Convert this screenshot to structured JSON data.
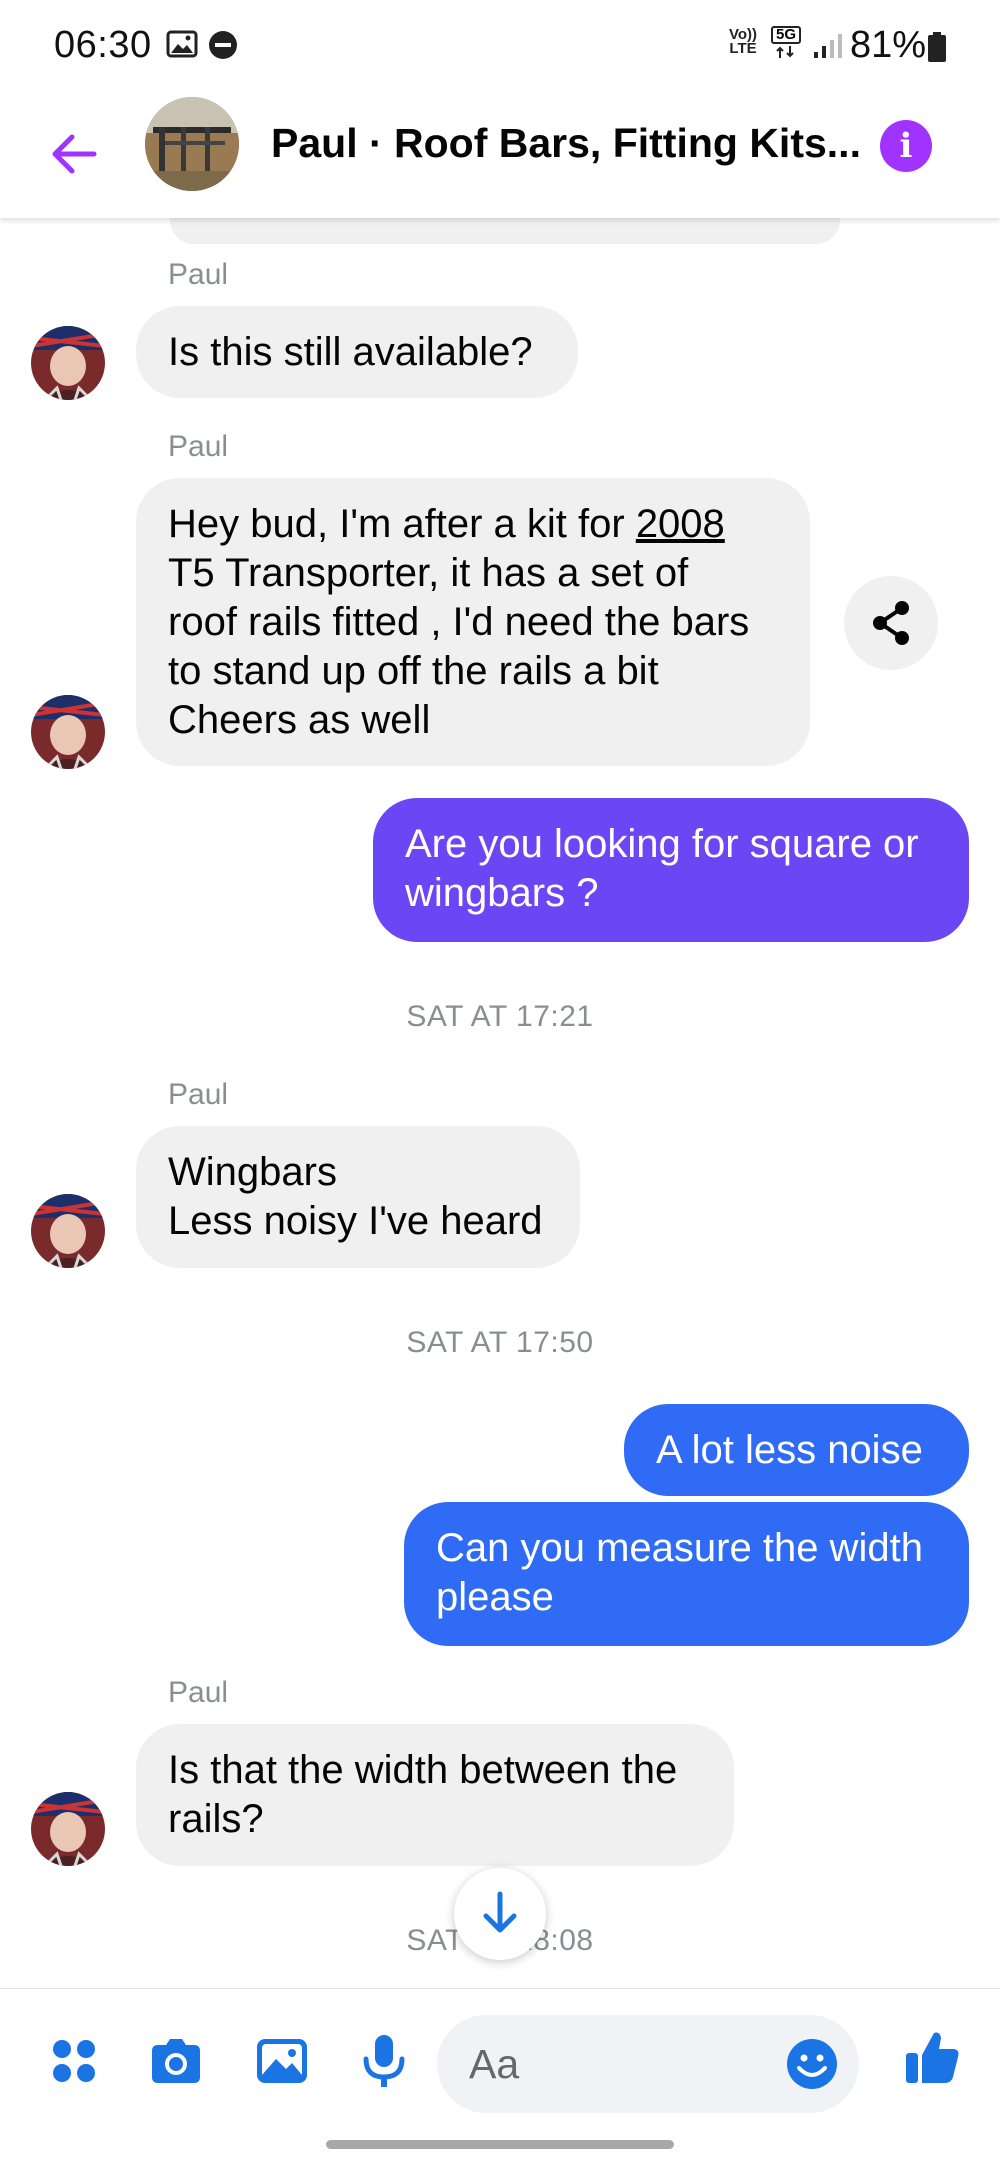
{
  "status_bar": {
    "time": "06:30",
    "network_volte": "Vo)) LTE",
    "network_5g": "5G",
    "battery": "81%",
    "icons": [
      "gallery-icon",
      "do-not-disturb-icon",
      "signal-icon",
      "battery-icon"
    ]
  },
  "header": {
    "title": "Paul · Roof Bars, Fitting Kits...",
    "back_icon": "arrow-left-icon",
    "info_icon": "info-icon",
    "info_glyph": "i"
  },
  "messages": [
    {
      "type": "incoming",
      "sender": "Paul",
      "lines": [
        "Is this still available?"
      ]
    },
    {
      "type": "incoming",
      "sender": "Paul",
      "lines": [
        "Hey bud, I'm after a kit for 2008",
        "T5 Transporter,  it has a set of",
        "roof rails fitted , I'd need the bars",
        "to stand up off the rails a bit",
        "Cheers  as well"
      ]
    },
    {
      "type": "outgoing",
      "lines": [
        "Are you looking for square or",
        "wingbars ?"
      ]
    },
    {
      "type": "timestamp",
      "text": "SAT AT 17:21"
    },
    {
      "type": "incoming",
      "sender": "Paul",
      "lines": [
        "Wingbars",
        "Less noisy I've heard"
      ]
    },
    {
      "type": "timestamp",
      "text": "SAT AT 17:50"
    },
    {
      "type": "outgoing",
      "lines": [
        "A lot less noise"
      ]
    },
    {
      "type": "outgoing",
      "lines": [
        "Can you measure the width",
        "please"
      ]
    },
    {
      "type": "incoming",
      "sender": "Paul",
      "lines": [
        "Is that the width between the",
        "rails?"
      ]
    },
    {
      "type": "timestamp",
      "text": "SAT AT 18:08"
    }
  ],
  "composer": {
    "placeholder": "Aa",
    "icons": [
      "apps-icon",
      "camera-icon",
      "image-icon",
      "microphone-icon",
      "emoji-icon",
      "thumbs-up-icon"
    ]
  },
  "colors": {
    "accent_purple": "#a033ff",
    "outgoing_purple": "#6b46f5",
    "outgoing_blue": "#2f6bf5",
    "incoming_bg": "#f0f0f0",
    "icon_blue": "#1b74e4"
  }
}
